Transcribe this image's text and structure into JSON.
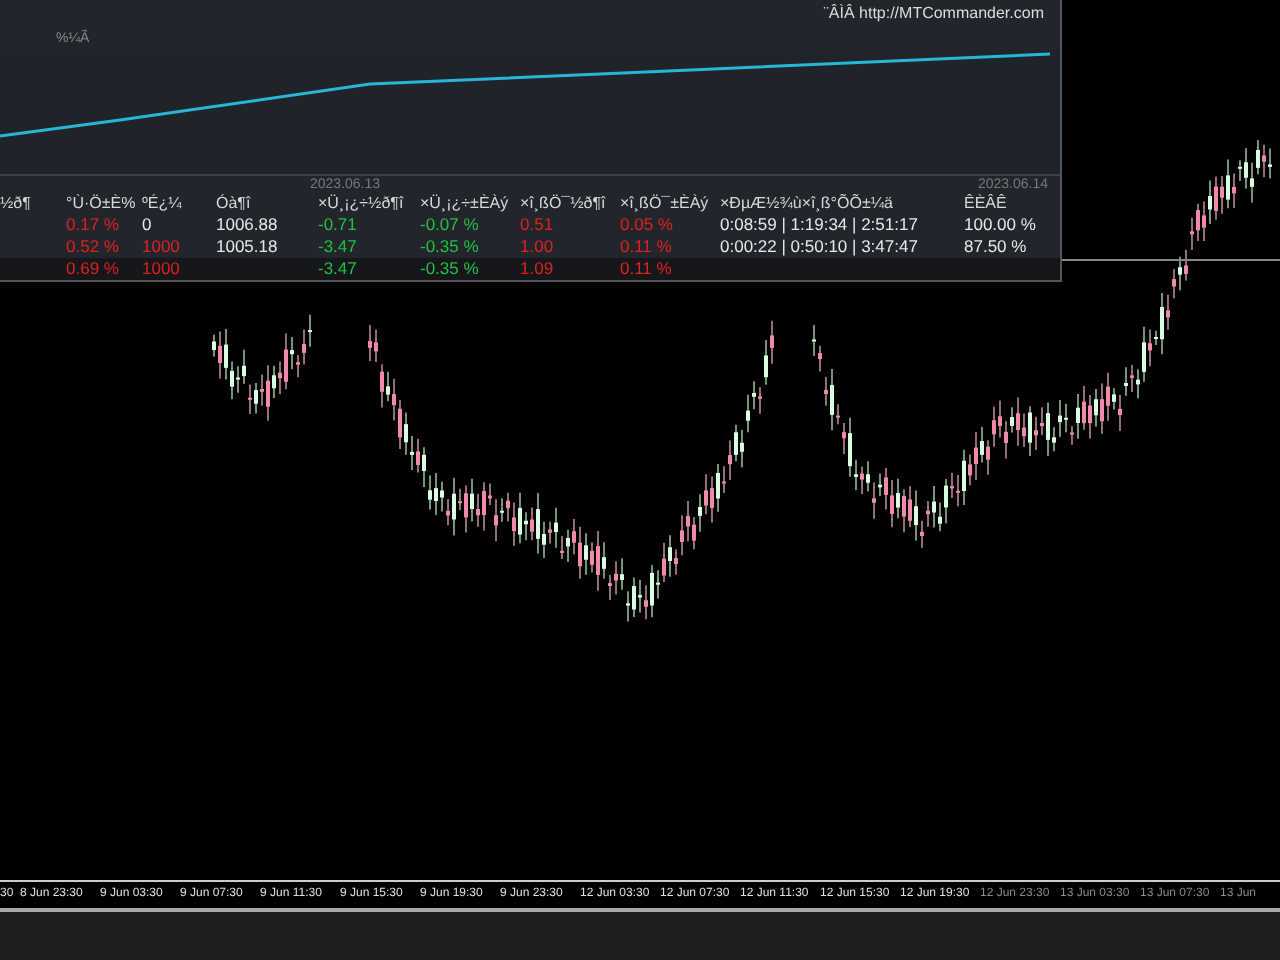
{
  "panel": {
    "link": "¨ÂÌÂ http://MTCommander.com",
    "plot_label": "%¼Ã",
    "dates": [
      "2023.06.13",
      "2023.06.14"
    ],
    "columns": [
      "½ð¶",
      "°Ù·Ö±È%",
      "ºÉ¿¼",
      "Óà¶î",
      "×Ü¸¡¿÷½ð¶î",
      "×Ü¸¡¿÷±ÈÀý",
      "×î¸ßÖ¯½ð¶î",
      "×î¸ßÖ¯±ÈÀý",
      "×ÐµÆ½¾ù×î¸ß°ÕÕ±¼ä",
      "ÊÈÂÊ"
    ],
    "rows": [
      {
        "kind": "item",
        "cells": [
          null,
          {
            "text": "0.17 %",
            "color": "#e02020"
          },
          {
            "text": "0",
            "color": "#e8e8e8"
          },
          {
            "text": "1006.88",
            "color": "#e8e8e8"
          },
          {
            "text": "-0.71",
            "color": "#20c040"
          },
          {
            "text": "-0.07 %",
            "color": "#20c040"
          },
          {
            "text": "0.51",
            "color": "#e02020"
          },
          {
            "text": "0.05 %",
            "color": "#e02020"
          },
          {
            "text": "0:08:59 | 1:19:34 | 2:51:17",
            "color": "#e8e8e8"
          },
          {
            "text": "100.00 %",
            "color": "#e8e8e8"
          }
        ]
      },
      {
        "kind": "item",
        "cells": [
          null,
          {
            "text": "0.52 %",
            "color": "#e02020"
          },
          {
            "text": "1000",
            "color": "#e02020"
          },
          {
            "text": "1005.18",
            "color": "#e8e8e8"
          },
          {
            "text": "-3.47",
            "color": "#20c040"
          },
          {
            "text": "-0.35 %",
            "color": "#20c040"
          },
          {
            "text": "1.00",
            "color": "#e02020"
          },
          {
            "text": "0.11 %",
            "color": "#e02020"
          },
          {
            "text": "0:00:22 | 0:50:10 | 3:47:47",
            "color": "#e8e8e8"
          },
          {
            "text": "87.50 %",
            "color": "#e8e8e8"
          }
        ]
      },
      {
        "kind": "total",
        "cells": [
          null,
          {
            "text": "0.69 %",
            "color": "#e02020"
          },
          {
            "text": "1000",
            "color": "#e02020"
          },
          null,
          {
            "text": "-3.47",
            "color": "#20c040"
          },
          {
            "text": "-0.35 %",
            "color": "#20c040"
          },
          {
            "text": "1.09",
            "color": "#e02020"
          },
          {
            "text": "0.11 %",
            "color": "#e02020"
          },
          null,
          null
        ]
      }
    ]
  },
  "time_axis": [
    "30",
    "8 Jun 23:30",
    "9 Jun 03:30",
    "9 Jun 07:30",
    "9 Jun 11:30",
    "9 Jun 15:30",
    "9 Jun 19:30",
    "9 Jun 23:30",
    "12 Jun 03:30",
    "12 Jun 07:30",
    "12 Jun 11:30",
    "12 Jun 15:30",
    "12 Jun 19:30",
    "12 Jun 23:30",
    "13 Jun 03:30",
    "13 Jun 07:30",
    "13 Jun"
  ]
}
